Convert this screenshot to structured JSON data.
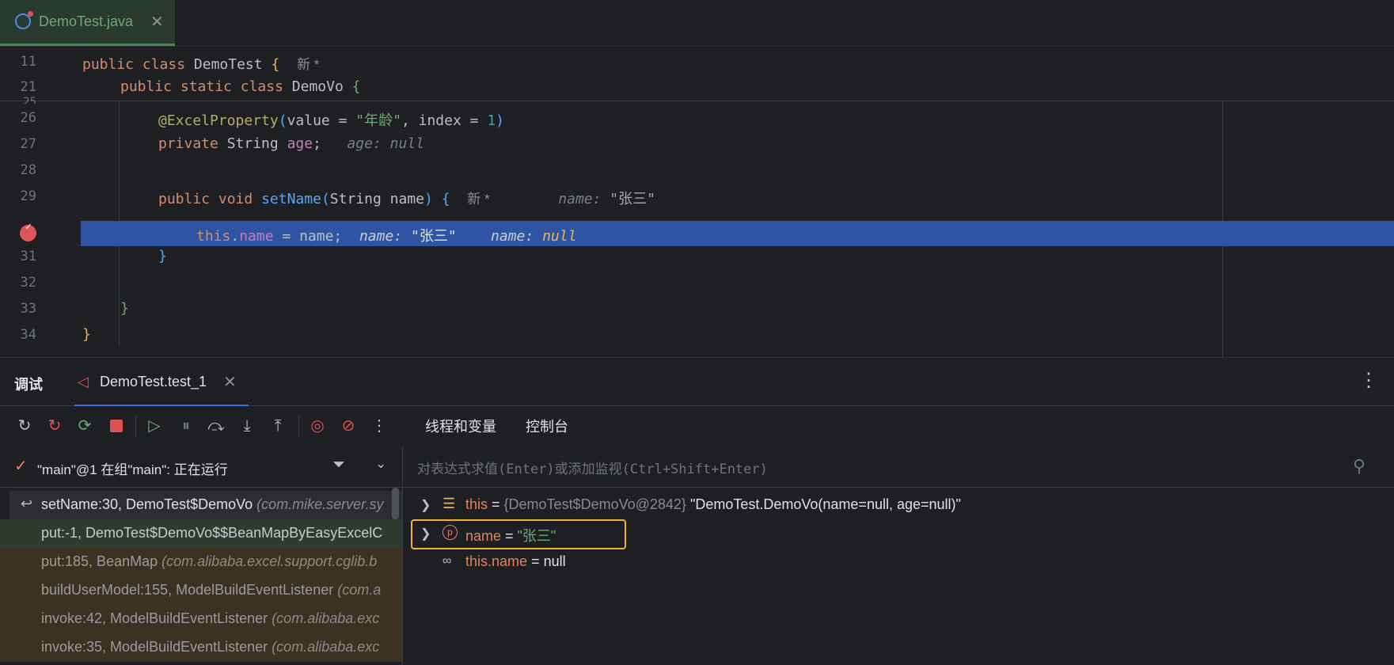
{
  "tab": {
    "filename": "DemoTest.java",
    "close": "✕"
  },
  "editor": {
    "lines": [
      {
        "num": "11"
      },
      {
        "num": "21"
      },
      {
        "num": "25"
      },
      {
        "num": "26"
      },
      {
        "num": "27"
      },
      {
        "num": "28"
      },
      {
        "num": "29"
      },
      {
        "num": "31"
      },
      {
        "num": "32"
      },
      {
        "num": "33"
      },
      {
        "num": "34"
      }
    ],
    "l11": {
      "kw1": "public",
      "kw2": "class",
      "name": "DemoTest",
      "brace": "{",
      "badge": "新 *"
    },
    "l21": {
      "kw1": "public",
      "kw2": "static",
      "kw3": "class",
      "name": "DemoVo",
      "brace": "{"
    },
    "l26": {
      "ann": "@ExcelProperty",
      "open": "(",
      "p1": "value = ",
      "s1": "\"年龄\"",
      "p2": ", index = ",
      "n1": "1",
      "close": ")"
    },
    "l27": {
      "kw": "private",
      "type": "String",
      "field": "age",
      "semi": ";",
      "hint": "age: null"
    },
    "l29": {
      "kw1": "public",
      "kw2": "void",
      "fn": "setName",
      "open": "(",
      "params": "String name",
      "close": ")",
      "brace": "{",
      "badge": "新 *",
      "hint_label": "name:",
      "hint_val": "\"张三\""
    },
    "l30": {
      "this": "this",
      "dot": ".",
      "field": "name",
      "rest": " = name;",
      "hint1_label": "name:",
      "hint1_val": "\"张三\"",
      "hint2_label": "name:",
      "hint2_val": "null"
    },
    "l31": {
      "brace": "}"
    },
    "l33": {
      "brace": "}"
    },
    "l34": {
      "brace": "}"
    }
  },
  "debug": {
    "title": "调试",
    "run_tab": "DemoTest.test_1",
    "run_close": "✕",
    "more": "⋮"
  },
  "toolbar": {
    "tabs": {
      "threads_vars": "线程和变量",
      "console": "控制台"
    }
  },
  "thread": {
    "label": "\"main\"@1 在组\"main\": 正在运行"
  },
  "frames": [
    {
      "method": "setName:30, DemoTest$DemoVo ",
      "pkg": "(com.mike.server.sy"
    },
    {
      "method": "put:-1, DemoTest$DemoVo$$BeanMapByEasyExcelC",
      "pkg": ""
    },
    {
      "method": "put:185, BeanMap ",
      "pkg": "(com.alibaba.excel.support.cglib.b"
    },
    {
      "method": "buildUserModel:155, ModelBuildEventListener ",
      "pkg": "(com.a"
    },
    {
      "method": "invoke:42, ModelBuildEventListener ",
      "pkg": "(com.alibaba.exc"
    },
    {
      "method": "invoke:35, ModelBuildEventListener ",
      "pkg": "(com.alibaba.exc"
    }
  ],
  "eval": {
    "placeholder": "对表达式求值(Enter)或添加监视(Ctrl+Shift+Enter)"
  },
  "variables": [
    {
      "name": "this",
      "eq": " = ",
      "type": "{DemoTest$DemoVo@2842}",
      "value": " \"DemoTest.DemoVo(name=null, age=null)\""
    },
    {
      "name": "name",
      "eq": " = ",
      "value": "\"张三\""
    },
    {
      "name": "this.name",
      "eq": " = ",
      "value": "null"
    }
  ],
  "colors": {
    "accent": "#3574f0",
    "exec_line": "#2e55a3",
    "focus": "#f2b532",
    "breakpoint": "#e0535b"
  }
}
